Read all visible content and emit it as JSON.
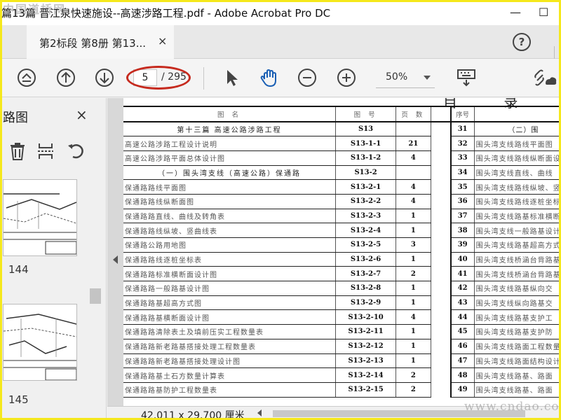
{
  "window": {
    "title": "篇13篇 晋江泉快速施设--高速涉路工程.pdf - Adobe Acrobat Pro DC",
    "watermark": "中国道桥网",
    "minimize": "—",
    "maximize": "☐"
  },
  "tab": {
    "label": "第2标段 第8册 第13...",
    "close": "×"
  },
  "help": "?",
  "toolbar": {
    "page_current": "5",
    "page_total": "/ 295",
    "zoom": "50%"
  },
  "left_panel": {
    "title": "路图",
    "close": "×",
    "thumbnails": [
      {
        "label": "144"
      },
      {
        "label": "145"
      }
    ]
  },
  "document": {
    "heading": "目 录",
    "header": {
      "name": "图  名",
      "code": "图 号",
      "pages": "页 数",
      "seq": "序号"
    },
    "rows": [
      {
        "name": "第十三篇  高速公路涉路工程",
        "code": "S13",
        "pages": "",
        "seq": "31",
        "right": "（二）围",
        "center": true,
        "rcenter": true
      },
      {
        "name": "高速公路涉路工程设计说明",
        "code": "S13-1-1",
        "pages": "21",
        "seq": "32",
        "right": "围头湾支线路线平面图"
      },
      {
        "name": "高速公路涉路平面总体设计图",
        "code": "S13-1-2",
        "pages": "4",
        "seq": "33",
        "right": "围头湾支线路线纵断面设计"
      },
      {
        "name": "（一）围头湾支线（高速公路）保通路",
        "code": "S13-2",
        "pages": "",
        "seq": "34",
        "right": "围头湾支线直线、曲线",
        "center": true
      },
      {
        "name": "保通路路线平面图",
        "code": "S13-2-1",
        "pages": "4",
        "seq": "35",
        "right": "围头湾支线路线纵坡、竖曲"
      },
      {
        "name": "保通路路线纵断面图",
        "code": "S13-2-2",
        "pages": "4",
        "seq": "36",
        "right": "围头湾支线路线逐桩坐标"
      },
      {
        "name": "保通路路直线、曲线及转角表",
        "code": "S13-2-3",
        "pages": "1",
        "seq": "37",
        "right": "围头湾支线路基标准横断"
      },
      {
        "name": "保通路路线纵坡、竖曲线表",
        "code": "S13-2-4",
        "pages": "1",
        "seq": "38",
        "right": "围头湾支线一般路基设计"
      },
      {
        "name": "保通路公路用地图",
        "code": "S13-2-5",
        "pages": "3",
        "seq": "39",
        "right": "围头湾支线路基超高方式"
      },
      {
        "name": "保通路路线逐桩坐标表",
        "code": "S13-2-6",
        "pages": "1",
        "seq": "40",
        "right": "围头湾支线桥涵台背路基"
      },
      {
        "name": "保通路路标准横断面设计图",
        "code": "S13-2-7",
        "pages": "2",
        "seq": "41",
        "right": "围头湾支线桥涵台背路基"
      },
      {
        "name": "保通路路一般路基设计图",
        "code": "S13-2-8",
        "pages": "1",
        "seq": "42",
        "right": "围头湾支线路基纵向交"
      },
      {
        "name": "保通路路基超高方式图",
        "code": "S13-2-9",
        "pages": "1",
        "seq": "43",
        "right": "围头湾支线纵向路基交"
      },
      {
        "name": "保通路路基横断面设计图",
        "code": "S13-2-10",
        "pages": "4",
        "seq": "44",
        "right": "围头湾支线路基支护工"
      },
      {
        "name": "保通路路清除表土及填前压实工程数量表",
        "code": "S13-2-11",
        "pages": "1",
        "seq": "45",
        "right": "围头湾支线路基支护防"
      },
      {
        "name": "保通路路新老路基搭接处理工程数量表",
        "code": "S13-2-12",
        "pages": "1",
        "seq": "46",
        "right": "围头湾支线路面工程数量"
      },
      {
        "name": "保通路路新老路基搭接处理设计图",
        "code": "S13-2-13",
        "pages": "1",
        "seq": "47",
        "right": "围头湾支线路面结构设计"
      },
      {
        "name": "保通路路基土石方数量计算表",
        "code": "S13-2-14",
        "pages": "2",
        "seq": "48",
        "right": "围头湾支线路基、路面"
      },
      {
        "name": "保通路路基防护工程数量表",
        "code": "S13-2-15",
        "pages": "2",
        "seq": "49",
        "right": "围头湾支线路基、路面"
      }
    ]
  },
  "status": {
    "dimensions": "42.011 x 29.700 厘米"
  },
  "site_watermark": "www.cndao.com",
  "colors": {
    "highlight_oval": "#c62a1e",
    "frame": "#f5e81c",
    "hand_tool": "#1a5fb4"
  }
}
